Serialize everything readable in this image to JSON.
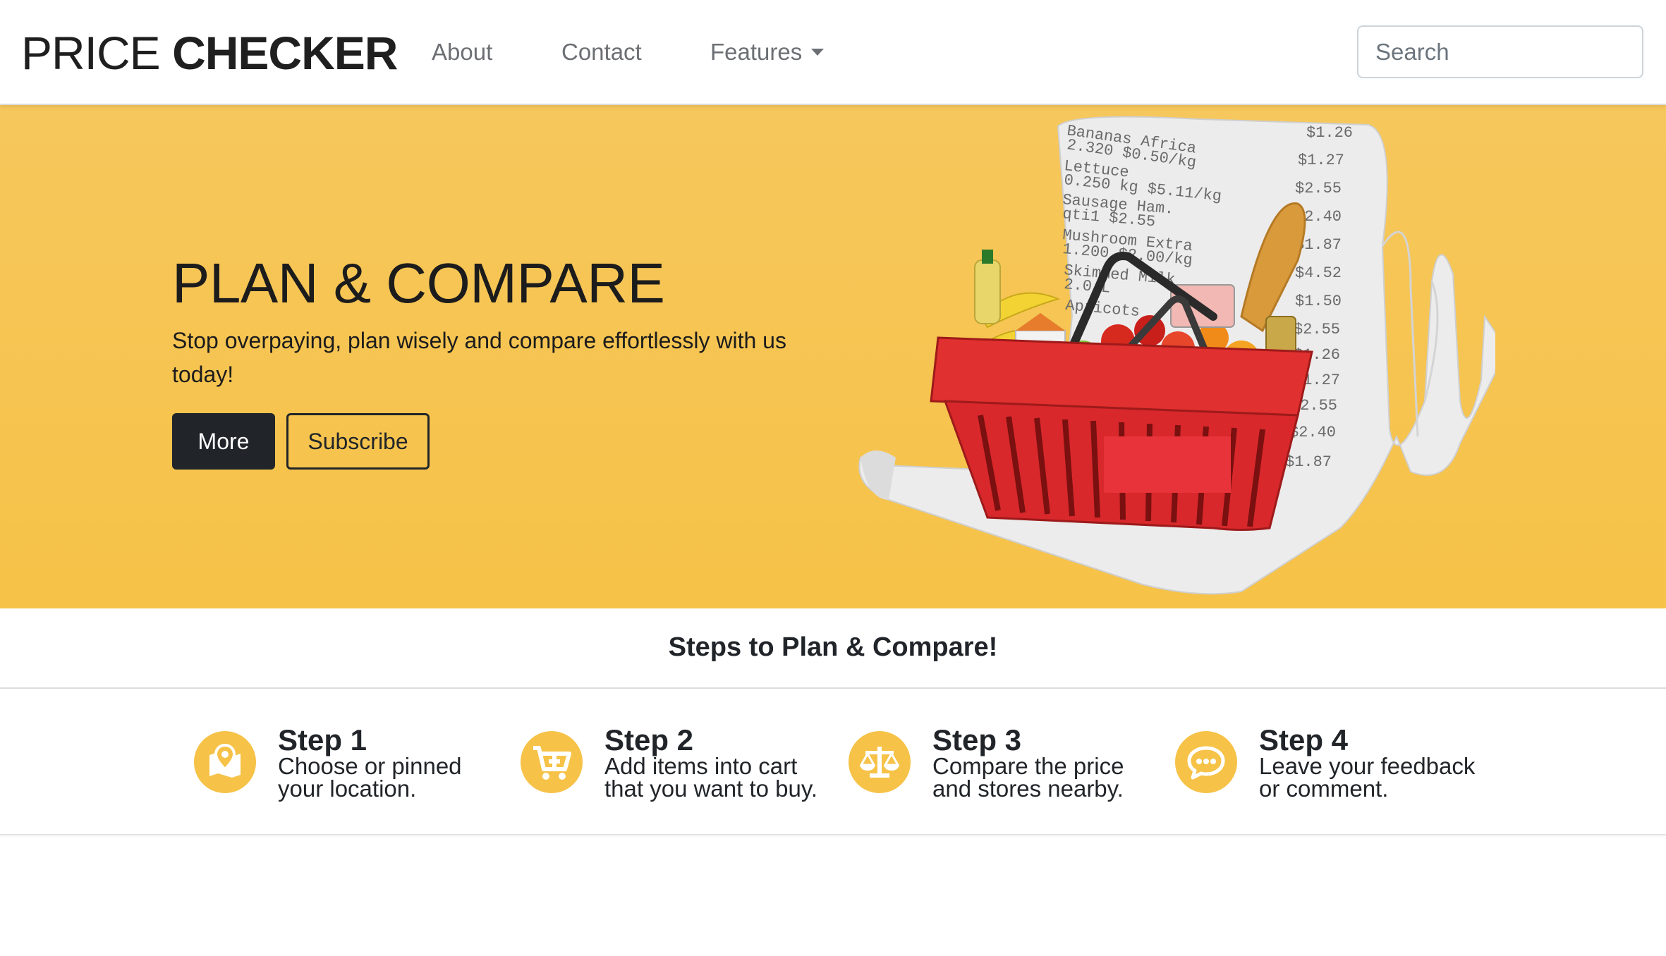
{
  "navbar": {
    "brand_light": "PRICE",
    "brand_bold": "CHECKER",
    "links": [
      {
        "label": "About"
      },
      {
        "label": "Contact"
      },
      {
        "label": "Features"
      }
    ],
    "search_placeholder": "Search"
  },
  "hero": {
    "title": "PLAN & COMPARE",
    "subtitle": "Stop overpaying, plan wisely and compare effortlessly with us today!",
    "buttons": {
      "more": "More",
      "subscribe": "Subscribe"
    },
    "receipt": {
      "items": [
        "Bananas Africa",
        "2.320   $0.50/kg",
        "Lettuce",
        "0.250 kg   $5.11/kg",
        "Sausage Ham.",
        "qti1  $2.55",
        "Mushroom Extra",
        "1.200   $2.00/kg",
        "Skimmed Milk",
        "2.0 L",
        "Apricots"
      ],
      "prices": [
        "$1.26",
        "$1.27",
        "$2.55",
        "$2.40",
        "$1.87",
        "$4.52",
        "$1.50",
        "$2.55",
        "$1.26",
        "$1.27",
        "$2.55",
        "$2.40",
        "$1.87"
      ]
    }
  },
  "steps": {
    "heading": "Steps to Plan & Compare!",
    "items": [
      {
        "title": "Step 1",
        "desc": "Choose or pinned your location.",
        "icon": "map-pin-icon"
      },
      {
        "title": "Step 2",
        "desc": "Add items into cart that you want to buy.",
        "icon": "cart-plus-icon"
      },
      {
        "title": "Step 3",
        "desc": "Compare the price and stores nearby.",
        "icon": "balance-scale-icon"
      },
      {
        "title": "Step 4",
        "desc": "Leave your feedback or comment.",
        "icon": "comment-dots-icon"
      }
    ]
  },
  "colors": {
    "accent": "#f6c247",
    "dark": "#212529",
    "basket_red": "#d8282c"
  }
}
